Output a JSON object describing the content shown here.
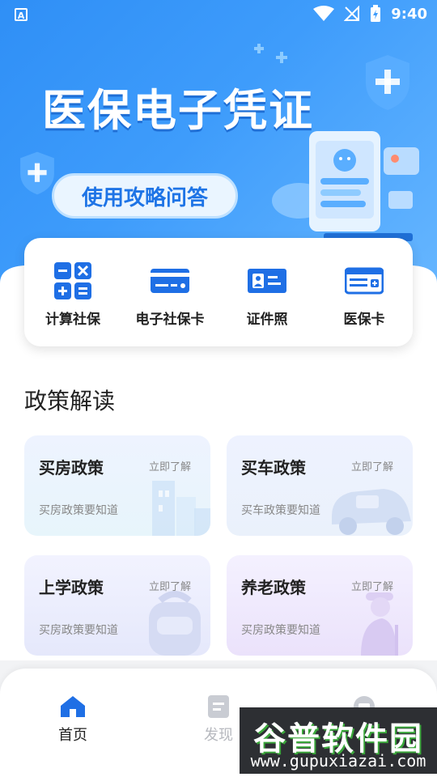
{
  "status_bar": {
    "time": "9:40",
    "app_icon_letter": "A"
  },
  "banner": {
    "title": "医保电子凭证",
    "subtitle": "使用攻略问答"
  },
  "quick_actions": [
    {
      "label": "计算社保",
      "icon": "calculator-icon"
    },
    {
      "label": "电子社保卡",
      "icon": "card-icon"
    },
    {
      "label": "证件照",
      "icon": "id-photo-icon"
    },
    {
      "label": "医保卡",
      "icon": "medical-card-icon"
    }
  ],
  "section": {
    "title": "政策解读"
  },
  "policies": [
    {
      "title": "买房政策",
      "link": "立即了解",
      "subtitle": "买房政策要知道",
      "icon": "building-icon"
    },
    {
      "title": "买车政策",
      "link": "立即了解",
      "subtitle": "买车政策要知道",
      "icon": "car-icon"
    },
    {
      "title": "上学政策",
      "link": "立即了解",
      "subtitle": "买房政策要知道",
      "icon": "backpack-icon"
    },
    {
      "title": "养老政策",
      "link": "立即了解",
      "subtitle": "买房政策要知道",
      "icon": "elderly-icon"
    }
  ],
  "bottom_nav": [
    {
      "label": "首页",
      "icon": "home-icon",
      "active": true
    },
    {
      "label": "发现",
      "icon": "document-icon",
      "active": false
    },
    {
      "label": "",
      "icon": "message-icon",
      "active": false
    }
  ],
  "watermark": {
    "text": "谷普软件园",
    "url": "www.gupuxiazai.com"
  },
  "colors": {
    "primary": "#2f8ff6",
    "icon_blue": "#1f6fe5",
    "text": "#222222",
    "muted": "#888888"
  }
}
